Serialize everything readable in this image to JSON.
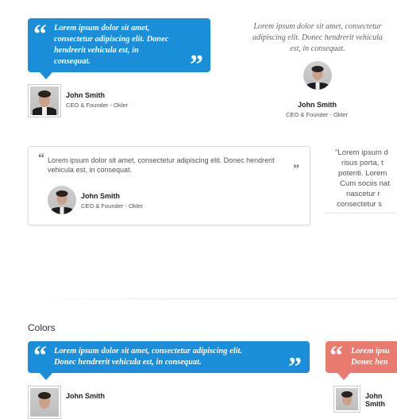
{
  "quote_text": "Lorem ipsum dolor sit amet, consectetur adipiscing elit. Donec hendrerit vehicula est, in consequat.",
  "quote_lines_a": [
    "Lorem ipsum dolor sit amet,",
    "consectetur adipiscing elit. Donec",
    "hendrerit vehicula est, in",
    "consequat."
  ],
  "quote_lines_b": [
    "Lorem ipsum dolor sit amet, consectetur",
    "adipiscing elit. Donec hendrerit vehicula",
    "est, in consequat."
  ],
  "quote_lines_c": [
    "Lorem ipsum dolor sit amet, consectetur adipiscing elit. Donec hendrerit",
    "vehicula est, in consequat."
  ],
  "quote_lines_d": [
    "\"Lorem ipsum d",
    "risus porta, t",
    "potenti. Lorem",
    "Cum sociis nat",
    "nascetur r",
    "consectetur s"
  ],
  "quote_lines_e": [
    "Lorem ipsum dolor sit amet, consectetur adipiscing elit.",
    "Donec hendrerit vehicula est, in consequat."
  ],
  "quote_lines_f": [
    "Lorem ipsu",
    "Donec hen"
  ],
  "author": {
    "name": "John Smith",
    "role": "CEO & Founder - Okler"
  },
  "section_colors_title": "Colors",
  "colors": {
    "blue": "#1b8ed9",
    "red": "#e97a6e"
  },
  "icons": {
    "open_quote": "“",
    "close_quote": "”"
  }
}
